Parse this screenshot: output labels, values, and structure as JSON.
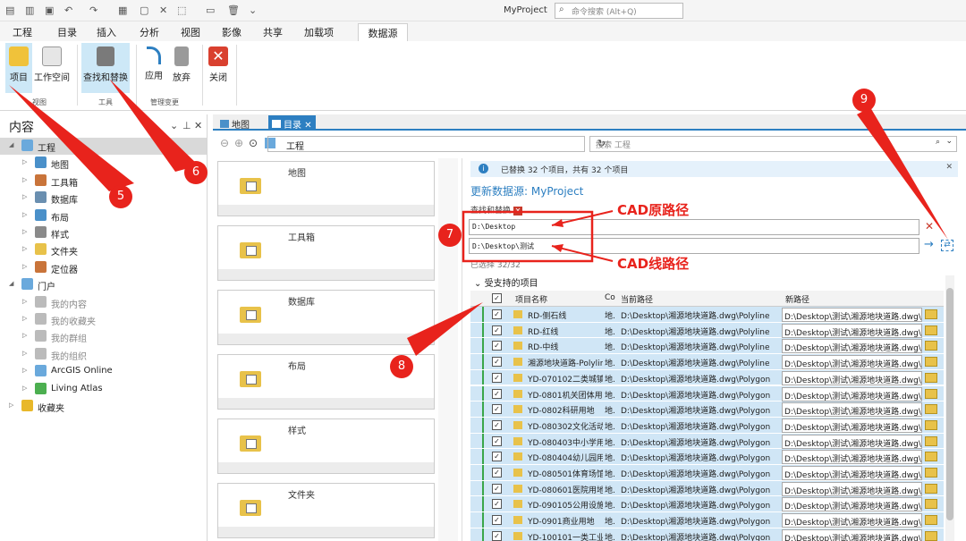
{
  "window": {
    "title": "MyProject",
    "command_search_placeholder": "命令搜索 (Alt+Q)"
  },
  "ribbon_tabs": [
    "工程",
    "目录",
    "插入",
    "分析",
    "视图",
    "影像",
    "共享",
    "加载项",
    "数据源"
  ],
  "ribbon": {
    "project_button": "项目",
    "workspace_button": "工作空间",
    "find_replace_button": "查找和替换",
    "apply_button": "应用",
    "discard_button": "放弃",
    "close_button": "关闭",
    "group_view": "视图",
    "group_tools": "工具",
    "group_manage": "管理变更"
  },
  "contents": {
    "title": "内容",
    "tree": [
      {
        "label": "工程",
        "level": 0,
        "color": "#6aa9dc"
      },
      {
        "label": "地图",
        "level": 1,
        "color": "#4a90c9"
      },
      {
        "label": "工具箱",
        "level": 1,
        "color": "#c9743a"
      },
      {
        "label": "数据库",
        "level": 1,
        "color": "#6a8fb0"
      },
      {
        "label": "布局",
        "level": 1,
        "color": "#4a90c9"
      },
      {
        "label": "样式",
        "level": 1,
        "color": "#8a8a8a"
      },
      {
        "label": "文件夹",
        "level": 1,
        "color": "#e8c24a"
      },
      {
        "label": "定位器",
        "level": 1,
        "color": "#c9743a"
      },
      {
        "label": "门户",
        "level": 0,
        "color": "#6aa9dc"
      },
      {
        "label": "我的内容",
        "level": 1,
        "color": "#bbbbbb",
        "gray": true
      },
      {
        "label": "我的收藏夹",
        "level": 1,
        "color": "#bbbbbb",
        "gray": true
      },
      {
        "label": "我的群组",
        "level": 1,
        "color": "#bbbbbb",
        "gray": true
      },
      {
        "label": "我的组织",
        "level": 1,
        "color": "#bbbbbb",
        "gray": true
      },
      {
        "label": "ArcGIS Online",
        "level": 1,
        "color": "#6aa9dc"
      },
      {
        "label": "Living Atlas",
        "level": 1,
        "color": "#4caf50"
      },
      {
        "label": "收藏夹",
        "level": 0,
        "color": "#e8b82a"
      }
    ]
  },
  "doc_tabs": {
    "map_tab": "地图",
    "catalog_tab": "目录"
  },
  "catalog": {
    "path": "工程",
    "search_placeholder": "搜索 工程",
    "cards": [
      "地图",
      "工具箱",
      "数据库",
      "布局",
      "样式",
      "文件夹"
    ]
  },
  "datasource": {
    "info": "已替换 32 个项目，共有 32 个项目",
    "update_title": "更新数据源: MyProject",
    "find_replace_label": "查找和替换",
    "find_value": "D:\\Desktop",
    "replace_value": "D:\\Desktop\\测试",
    "selected_count": "已选择 32/32",
    "section_title": "受支持的项目",
    "columns": {
      "name": "项目名称",
      "co": "Co",
      "current": "当前路径",
      "new": "新路径"
    },
    "rows": [
      {
        "name": "RD-侧石线",
        "co": "地.",
        "current": "D:\\Desktop\\湘源地块道路.dwg\\Polyline",
        "new": "D:\\Desktop\\测试\\湘源地块道路.dwg\\Pc"
      },
      {
        "name": "RD-红线",
        "co": "地.",
        "current": "D:\\Desktop\\湘源地块道路.dwg\\Polyline",
        "new": "D:\\Desktop\\测试\\湘源地块道路.dwg\\Pc"
      },
      {
        "name": "RD-中线",
        "co": "地.",
        "current": "D:\\Desktop\\湘源地块道路.dwg\\Polyline",
        "new": "D:\\Desktop\\测试\\湘源地块道路.dwg\\Pc"
      },
      {
        "name": "湘源地块道路-Polylin",
        "co": "地.",
        "current": "D:\\Desktop\\湘源地块道路.dwg\\Polyline",
        "new": "D:\\Desktop\\测试\\湘源地块道路.dwg\\Pc"
      },
      {
        "name": "YD-070102二类城镇",
        "co": "地.",
        "current": "D:\\Desktop\\湘源地块道路.dwg\\Polygon",
        "new": "D:\\Desktop\\测试\\湘源地块道路.dwg\\Pc"
      },
      {
        "name": "YD-0801机关团体用",
        "co": "地.",
        "current": "D:\\Desktop\\湘源地块道路.dwg\\Polygon",
        "new": "D:\\Desktop\\测试\\湘源地块道路.dwg\\Pc"
      },
      {
        "name": "YD-0802科研用地",
        "co": "地.",
        "current": "D:\\Desktop\\湘源地块道路.dwg\\Polygon",
        "new": "D:\\Desktop\\测试\\湘源地块道路.dwg\\Pc"
      },
      {
        "name": "YD-080302文化活动",
        "co": "地.",
        "current": "D:\\Desktop\\湘源地块道路.dwg\\Polygon",
        "new": "D:\\Desktop\\测试\\湘源地块道路.dwg\\Pc"
      },
      {
        "name": "YD-080403中小学用",
        "co": "地.",
        "current": "D:\\Desktop\\湘源地块道路.dwg\\Polygon",
        "new": "D:\\Desktop\\测试\\湘源地块道路.dwg\\Pc"
      },
      {
        "name": "YD-080404幼儿园用",
        "co": "地.",
        "current": "D:\\Desktop\\湘源地块道路.dwg\\Polygon",
        "new": "D:\\Desktop\\测试\\湘源地块道路.dwg\\Pc"
      },
      {
        "name": "YD-080501体育场馆",
        "co": "地.",
        "current": "D:\\Desktop\\湘源地块道路.dwg\\Polygon",
        "new": "D:\\Desktop\\测试\\湘源地块道路.dwg\\Pc"
      },
      {
        "name": "YD-080601医院用地",
        "co": "地.",
        "current": "D:\\Desktop\\湘源地块道路.dwg\\Polygon",
        "new": "D:\\Desktop\\测试\\湘源地块道路.dwg\\Pc"
      },
      {
        "name": "YD-090105公用设施",
        "co": "地.",
        "current": "D:\\Desktop\\湘源地块道路.dwg\\Polygon",
        "new": "D:\\Desktop\\测试\\湘源地块道路.dwg\\Pc"
      },
      {
        "name": "YD-0901商业用地",
        "co": "地.",
        "current": "D:\\Desktop\\湘源地块道路.dwg\\Polygon",
        "new": "D:\\Desktop\\测试\\湘源地块道路.dwg\\Pc"
      },
      {
        "name": "YD-100101一类工业",
        "co": "地.",
        "current": "D:\\Desktop\\湘源地块道路.dwg\\Polygon",
        "new": "D:\\Desktop\\测试\\湘源地块道路.dwg\\Pc"
      }
    ]
  },
  "annotations": {
    "cad_original": "CAD原路径",
    "cad_new": "CAD线路径",
    "markers": [
      "5",
      "6",
      "7",
      "8",
      "9"
    ]
  }
}
